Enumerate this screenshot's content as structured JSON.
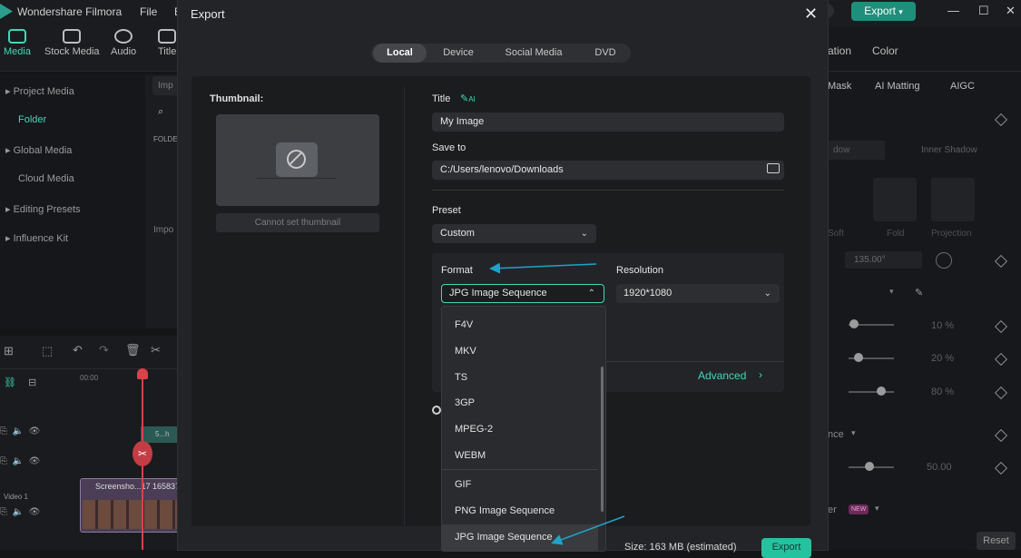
{
  "app": {
    "name": "Wondershare Filmora",
    "menus": [
      "File",
      "E"
    ],
    "export_label": "Export"
  },
  "toolbar": {
    "tabs": [
      "Media",
      "Stock Media",
      "Audio",
      "Title"
    ]
  },
  "sidebar": {
    "items": [
      "Project Media",
      "Folder",
      "Global Media",
      "Cloud Media",
      "Editing Presets",
      "Influence Kit"
    ]
  },
  "middle": {
    "import": "Imp",
    "folder": "FOLDE",
    "import2": "Impo"
  },
  "right_panel": {
    "tabs": [
      "ation",
      "Color"
    ],
    "subtabs": [
      "Mask",
      "AI Matting",
      "AIGC"
    ],
    "rows": [
      "dow",
      "Inner Shadow"
    ],
    "presets": [
      "Soft",
      "Fold",
      "Projection"
    ],
    "angle": "135.00°",
    "percents": [
      "10 %",
      "20 %",
      "80 %"
    ],
    "nce": "nce",
    "value": "50.00",
    "er": "er",
    "new_badge": "NEW",
    "reset": "Reset"
  },
  "timeline": {
    "time": "00:00",
    "clip_label": "Screensho...17 165837",
    "track_label": "Video 1",
    "sub_clip": "5...h"
  },
  "dialog": {
    "title": "Export",
    "tabs": [
      "Local",
      "Device",
      "Social Media",
      "DVD"
    ],
    "active_tab": "Local",
    "thumbnail_label": "Thumbnail:",
    "thumbnail_button": "Cannot set thumbnail",
    "title_label": "Title",
    "ai_icon": "AI",
    "title_value": "My Image",
    "save_to_label": "Save to",
    "save_to_value": "C:/Users/lenovo/Downloads",
    "preset_label": "Preset",
    "preset_value": "Custom",
    "format_label": "Format",
    "format_value": "JPG Image Sequence",
    "resolution_label": "Resolution",
    "resolution_value": "1920*1080",
    "advanced_label": "Advanced",
    "format_options": [
      "F4V",
      "MKV",
      "TS",
      "3GP",
      "MPEG-2",
      "WEBM",
      "GIF",
      "PNG Image Sequence",
      "JPG Image Sequence"
    ],
    "selected_option": "JPG Image Sequence",
    "size_text": "Size: 163 MB (estimated)",
    "export_button": "Export"
  },
  "colors": {
    "accent": "#3dd9b9",
    "annotation_arrow": "#1ea3c8"
  }
}
